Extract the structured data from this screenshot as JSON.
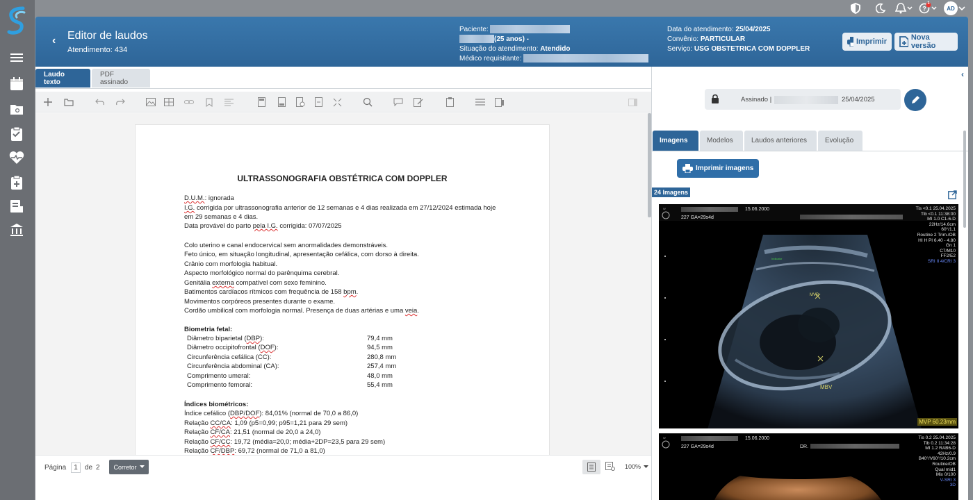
{
  "header": {
    "title": "Editor de laudos",
    "subtitle": "Atendimento: 434",
    "patient_label": "Paciente:",
    "patient_age": "(25 anos) -",
    "status_label": "Situação do atendimento:",
    "status_value": "Atendido",
    "doctor_label": "Médico requisitante:",
    "date_label": "Data do atendimento:",
    "date_value": "25/04/2025",
    "insurance_label": "Convênio:",
    "insurance_value": "PARTICULAR",
    "service_label": "Serviço:",
    "service_value": "USG OBSTETRICA COM DOPPLER",
    "print_label": "Imprimir",
    "new_version_label": "Nova versão"
  },
  "topbar": {
    "avatar": "AD",
    "help_badge": "1"
  },
  "editor": {
    "tabs": [
      "Laudo texto",
      "PDF assinado"
    ],
    "document": {
      "title": "ULTRASSONOGRAFIA OBSTÉTRICA COM DOPPLER",
      "intro": [
        "D.U.M.: ignorada",
        "I.G. corrigida por ultrassonografia anterior de 12 semanas e 4 dias realizada em 27/12/2024 estimada hoje",
        "em 29 semanas e 4 dias.",
        "Data provável do parto pela I.G. corrigida: 07/07/2025"
      ],
      "findings": [
        "Colo uterino e canal endocervical sem anormalidades demonstráveis.",
        "Feto único, em situação longitudinal, apresentação cefálica, com dorso à direita.",
        "Crânio com morfologia habitual.",
        "Aspecto morfológico normal do parênquima cerebral.",
        "Genitália externa compatível com sexo feminino.",
        "Batimentos cardíacos rítmicos com frequência de 158 bpm.",
        "Movimentos corpóreos presentes durante o exame.",
        "Cordão umbilical com morfologia normal. Presença de duas artérias e uma veia."
      ],
      "biometry_title": "Biometria fetal:",
      "biometry": [
        {
          "label": "Diâmetro biparietal (DBP):",
          "value": "79,4 mm"
        },
        {
          "label": "Diâmetro occipitofrontal (DOF):",
          "value": "94,5 mm"
        },
        {
          "label": "Circunferência cefálica (CC):",
          "value": "280,8 mm"
        },
        {
          "label": "Circunferência abdominal (CA):",
          "value": "257,4 mm"
        },
        {
          "label": "Comprimento umeral:",
          "value": "48,0 mm"
        },
        {
          "label": "Comprimento femoral:",
          "value": "55,4 mm"
        }
      ],
      "indices_title": "Índices biométricos:",
      "indices": [
        "Índice cefálico (DBP/DOF): 84,01% (normal de 70,0 a 86,0)",
        "Relação CC/CA: 1,09 (p5=0,99; p95=1,21 para 29 sem)",
        "Relação CF/CA: 21,51 (normal de 20,0 a 24,0)",
        "Relação CF/CC: 19,72 (média=20,0; média+2DP=23,5 para 29 sem)",
        "Relação CF/DBP: 69,72 (normal de 71,0 a 81,0)"
      ]
    },
    "footer": {
      "page_label": "Página",
      "page_current": "1",
      "page_of": "de",
      "page_total": "2",
      "spellcheck_label": "Corretor",
      "zoom": "100%"
    }
  },
  "right_panel": {
    "signed_label": "Assinado |",
    "signed_date": "25/04/2025",
    "tabs": [
      "Imagens",
      "Modelos",
      "Laudos anteriores",
      "Evolução"
    ],
    "print_images_label": "Imprimir imagens",
    "images_count": "24 Imagens",
    "image1": {
      "date_a": "15.06.2000",
      "line2": "227  GA=29s4d",
      "right": [
        "Tis <0.1   25.04.2025",
        "Tib <0.1   11:38:00",
        "MI  1.0     C1-6-D",
        "22Hz/14.6cm",
        "60°/1.1",
        "Routine 2 Trim./OB",
        "HI H PI 6.40 - 4.80",
        "Gn  1",
        "C7/M10",
        "FF2/E2",
        "SRI II 4/CRI 3"
      ],
      "label_mvp": "MVP",
      "label_mbv": "MBV",
      "measure": "MVP 60.23mm"
    },
    "image2": {
      "date_a": "15.06.2000",
      "line2": "227  GA=29s4d",
      "dr": "DR.",
      "right": [
        "Tis 0.2   25.04.2025",
        "Tib 0.2   11:34:28",
        "MI  1.2    RAB6-D",
        "42Hz/0.9",
        "B40°/V60°/10.2cm",
        "Routine/OB",
        "Qual mid1",
        "Mix 0/100",
        "V-SRI 3",
        "3D"
      ]
    }
  }
}
